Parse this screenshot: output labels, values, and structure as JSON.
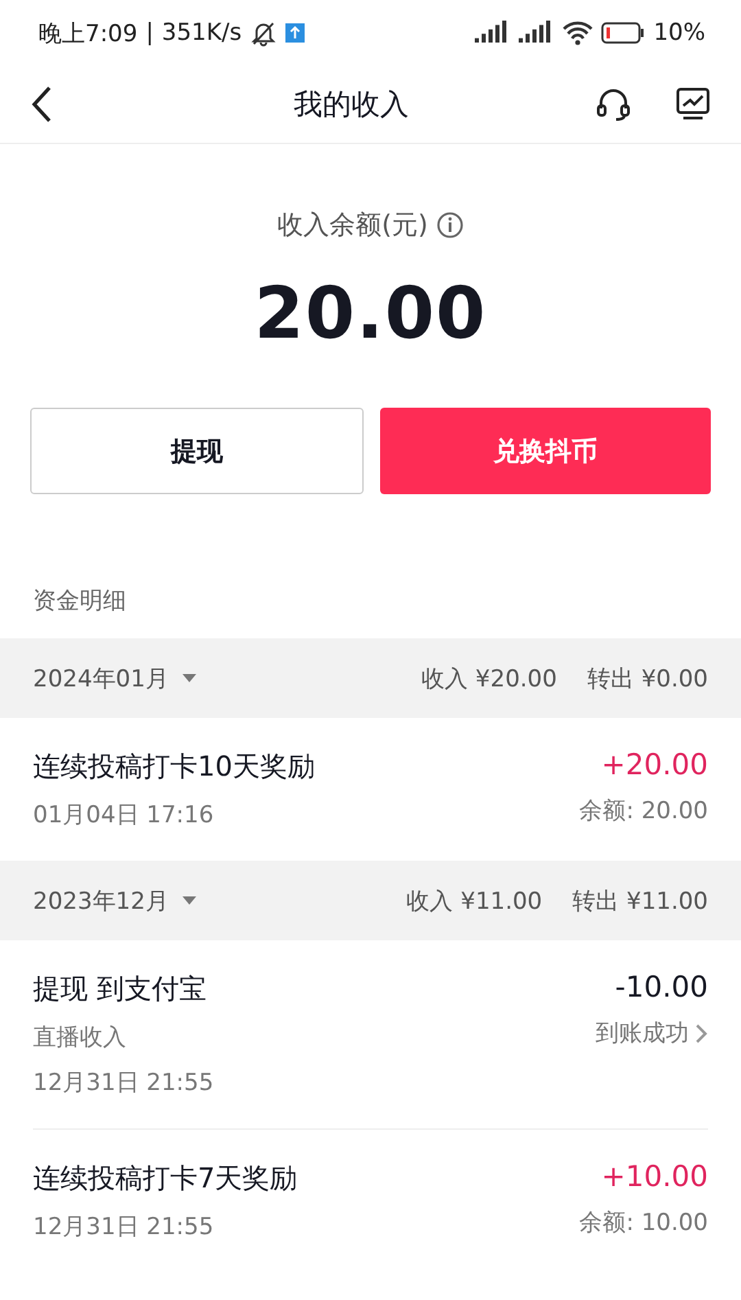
{
  "status_bar": {
    "time": "晚上7:09",
    "separator": "|",
    "speed": "351K/s",
    "battery": "10%"
  },
  "nav": {
    "title": "我的收入"
  },
  "balance": {
    "label": "收入余额(元)",
    "amount": "20.00"
  },
  "buttons": [
    {
      "label": "提现",
      "kind": "outline"
    },
    {
      "label": "兑换抖币",
      "kind": "primary"
    }
  ],
  "section_title": "资金明细",
  "months": [
    {
      "month": "2024年01月",
      "income": "收入 ¥20.00",
      "out": "转出 ¥0.00",
      "items": [
        {
          "kind": "income",
          "title": "连续投稿打卡10天奖励",
          "date": "01月04日 17:16",
          "amount": "+20.00",
          "balance": "余额: 20.00"
        }
      ]
    },
    {
      "month": "2023年12月",
      "income": "收入 ¥11.00",
      "out": "转出 ¥11.00",
      "items": [
        {
          "kind": "withdraw",
          "title": "提现 到支付宝",
          "source": "直播收入",
          "date": "12月31日 21:55",
          "amount": "-10.00",
          "status": "到账成功"
        },
        {
          "kind": "income",
          "title": "连续投稿打卡7天奖励",
          "date": "12月31日 21:55",
          "amount": "+10.00",
          "balance": "余额: 10.00"
        }
      ]
    }
  ]
}
